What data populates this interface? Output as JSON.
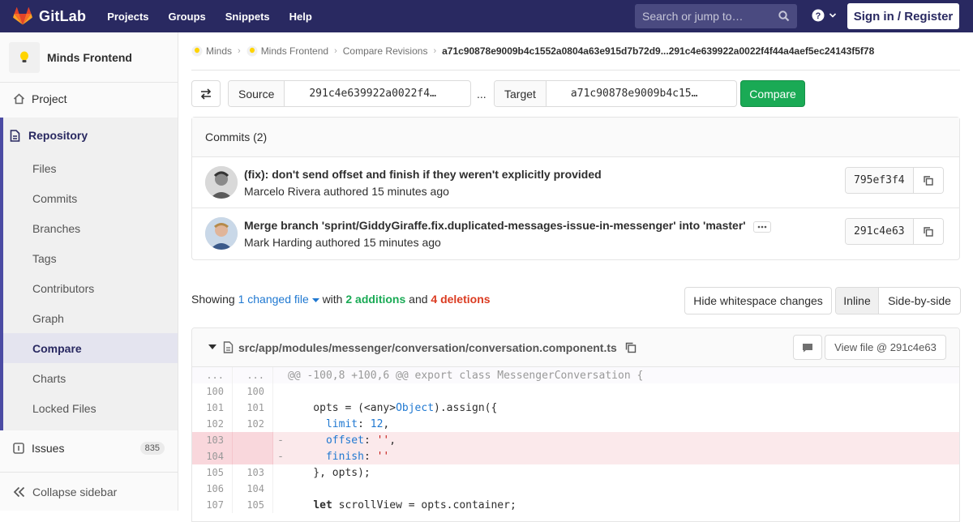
{
  "topbar": {
    "brand": "GitLab",
    "nav": [
      "Projects",
      "Groups",
      "Snippets",
      "Help"
    ],
    "search_placeholder": "Search or jump to…",
    "signin_label": "Sign in / Register"
  },
  "sidebar": {
    "project_name": "Minds Frontend",
    "project_label": "Project",
    "repository_label": "Repository",
    "repo_items": [
      "Files",
      "Commits",
      "Branches",
      "Tags",
      "Contributors",
      "Graph",
      "Compare",
      "Charts",
      "Locked Files"
    ],
    "active_item": "Compare",
    "issues_label": "Issues",
    "issues_count": "835",
    "collapse_label": "Collapse sidebar"
  },
  "breadcrumb": {
    "items": [
      "Minds",
      "Minds Frontend",
      "Compare Revisions"
    ],
    "current": "a71c90878e9009b4c1552a0804a63e915d7b72d9...291c4e639922a0022f4f44a4aef5ec24143f5f78"
  },
  "compare": {
    "source_label": "Source",
    "source_value": "291c4e639922a0022f4…",
    "separator": "...",
    "target_label": "Target",
    "target_value": "a71c90878e9009b4c15…",
    "compare_button": "Compare"
  },
  "commits": {
    "header": "Commits (2)",
    "items": [
      {
        "title": "(fix): don't send offset and finish if they weren't explicitly provided",
        "author": "Marcelo Rivera",
        "meta": "authored 15 minutes ago",
        "sha": "795ef3f4"
      },
      {
        "title": "Merge branch 'sprint/GiddyGiraffe.fix.duplicated-messages-issue-in-messenger' into 'master'",
        "author": "Mark Harding",
        "meta": "authored 15 minutes ago",
        "sha": "291c4e63"
      }
    ]
  },
  "summary": {
    "showing": "Showing",
    "changed": "1 changed file",
    "with": "with",
    "additions": "2 additions",
    "and": "and",
    "deletions": "4 deletions",
    "whitespace_button": "Hide whitespace changes",
    "inline_button": "Inline",
    "side_by_side_button": "Side-by-side"
  },
  "file": {
    "path": "src/app/modules/messenger/conversation/conversation.component.ts",
    "view_button": "View file @ 291c4e63",
    "hunk": "@@ -100,8 +100,6 @@ export class MessengerConversation {",
    "lines": [
      {
        "old": "...",
        "new": "...",
        "type": "hunk",
        "sign": "",
        "code": "@@ -100,8 +100,6 @@ export class MessengerConversation {"
      },
      {
        "old": "100",
        "new": "100",
        "type": "ctx",
        "sign": "",
        "code": ""
      },
      {
        "old": "101",
        "new": "101",
        "type": "ctx",
        "sign": "",
        "code": "    opts = (<any>Object).assign({"
      },
      {
        "old": "102",
        "new": "102",
        "type": "ctx",
        "sign": "",
        "code": "      limit: 12,"
      },
      {
        "old": "103",
        "new": "",
        "type": "del",
        "sign": "-",
        "code": "      offset: '',"
      },
      {
        "old": "104",
        "new": "",
        "type": "del",
        "sign": "-",
        "code": "      finish: ''"
      },
      {
        "old": "105",
        "new": "103",
        "type": "ctx",
        "sign": "",
        "code": "    }, opts);"
      },
      {
        "old": "106",
        "new": "104",
        "type": "ctx",
        "sign": "",
        "code": ""
      },
      {
        "old": "107",
        "new": "105",
        "type": "ctx",
        "sign": "",
        "code": "    let scrollView = opts.container;"
      }
    ]
  },
  "colors": {
    "header": "#292961",
    "accent": "#1f78d1",
    "green": "#1aaa55",
    "red": "#db3b21"
  }
}
